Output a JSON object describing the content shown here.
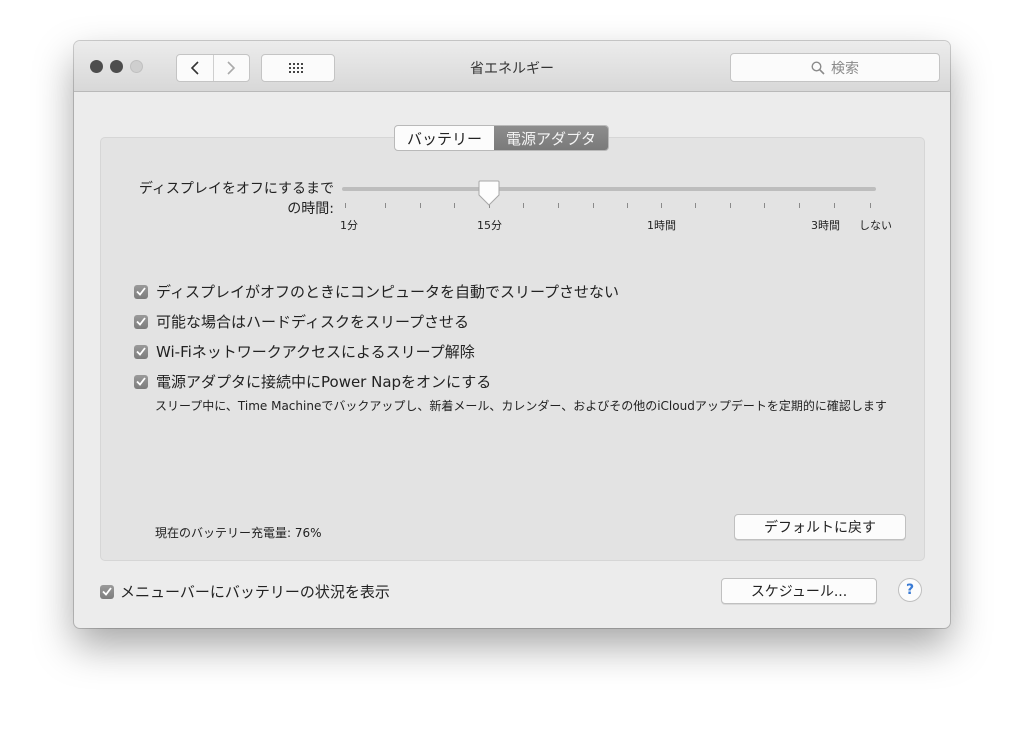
{
  "window": {
    "title": "省エネルギー"
  },
  "toolbar": {
    "search_placeholder": "検索"
  },
  "tabs": [
    {
      "label": "バッテリー",
      "active": false
    },
    {
      "label": "電源アダプタ",
      "active": true
    }
  ],
  "display_sleep": {
    "label_line1": "ディスプレイをオフにするまで",
    "label_line2": "の時間:",
    "selected_tick": "15分",
    "tick_labels": {
      "t1": "1分",
      "t15": "15分",
      "t1h": "1時間",
      "t3h": "3時間",
      "never": "しない"
    }
  },
  "options": [
    {
      "label": "ディスプレイがオフのときにコンピュータを自動でスリープさせない",
      "checked": true
    },
    {
      "label": "可能な場合はハードディスクをスリープさせる",
      "checked": true
    },
    {
      "label": "Wi-Fiネットワークアクセスによるスリープ解除",
      "checked": true
    },
    {
      "label": "電源アダプタに接続中にPower Napをオンにする",
      "checked": true
    }
  ],
  "power_nap_desc": "スリープ中に、Time Machineでバックアップし、新着メール、カレンダー、およびその他のiCloudアップデートを定期的に確認します",
  "battery_status": "現在のバッテリー充電量: 76%",
  "buttons": {
    "defaults": "デフォルトに戻す",
    "schedule": "スケジュール...",
    "help": "?"
  },
  "menubar_option": {
    "label": "メニューバーにバッテリーの状況を表示",
    "checked": true
  },
  "colors": {
    "accent": "#3a7bd5",
    "checkbox": "#8a8a8a",
    "segment_active": "#7f7f7f"
  }
}
